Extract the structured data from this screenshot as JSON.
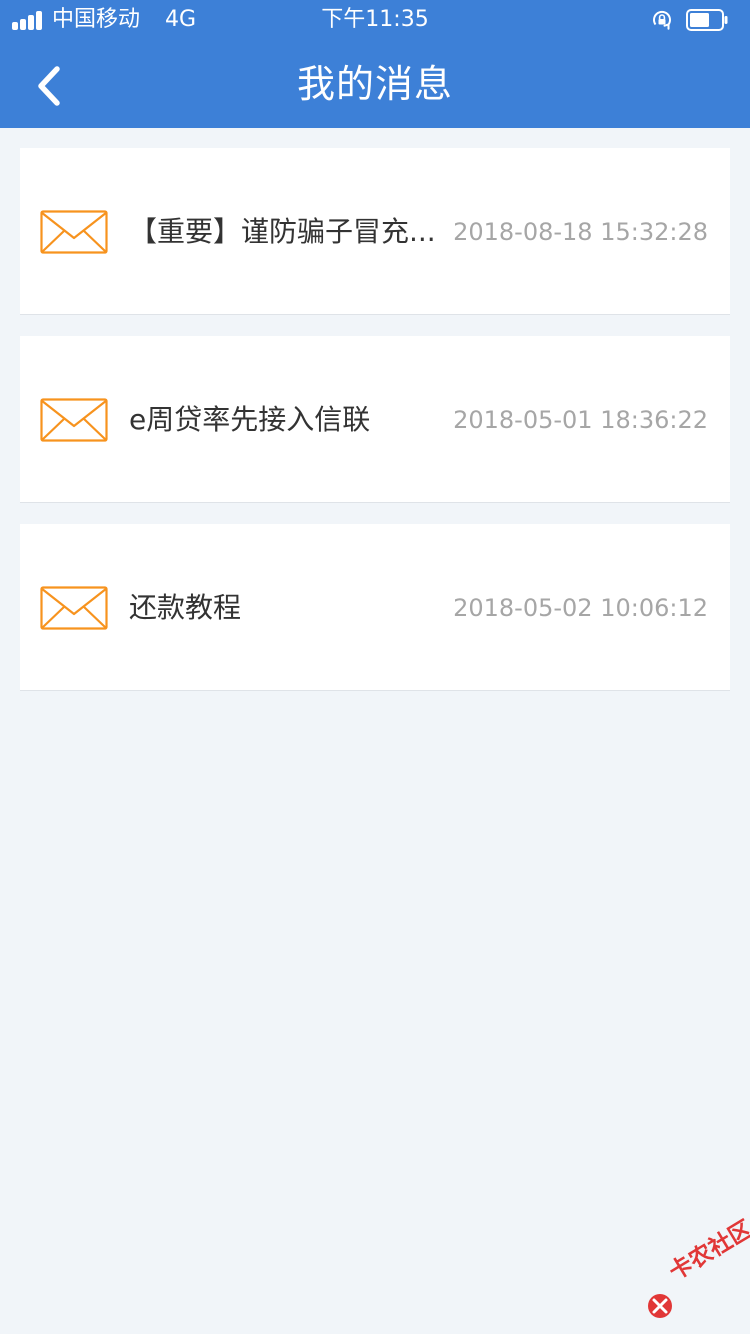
{
  "status_bar": {
    "carrier": "中国移动",
    "network": "4G",
    "time": "下午11:35"
  },
  "nav": {
    "title": "我的消息"
  },
  "messages": [
    {
      "title": "【重要】谨防骗子冒充...",
      "time": "2018-08-18 15:32:28"
    },
    {
      "title": "e周贷率先接入信联",
      "time": "2018-05-01 18:36:22"
    },
    {
      "title": "还款教程",
      "time": "2018-05-02 10:06:12"
    }
  ],
  "icons": {
    "back": "chevron-left-icon",
    "mail": "envelope-icon",
    "battery": "battery-icon",
    "rotation_lock": "rotation-lock-icon",
    "signal": "signal-icon"
  },
  "colors": {
    "nav_background": "#3d80d7",
    "mail_icon": "#f7931e",
    "time_text": "#a6a6a6",
    "watermark": "#e13737"
  },
  "watermark": {
    "text": "卡农社区"
  }
}
